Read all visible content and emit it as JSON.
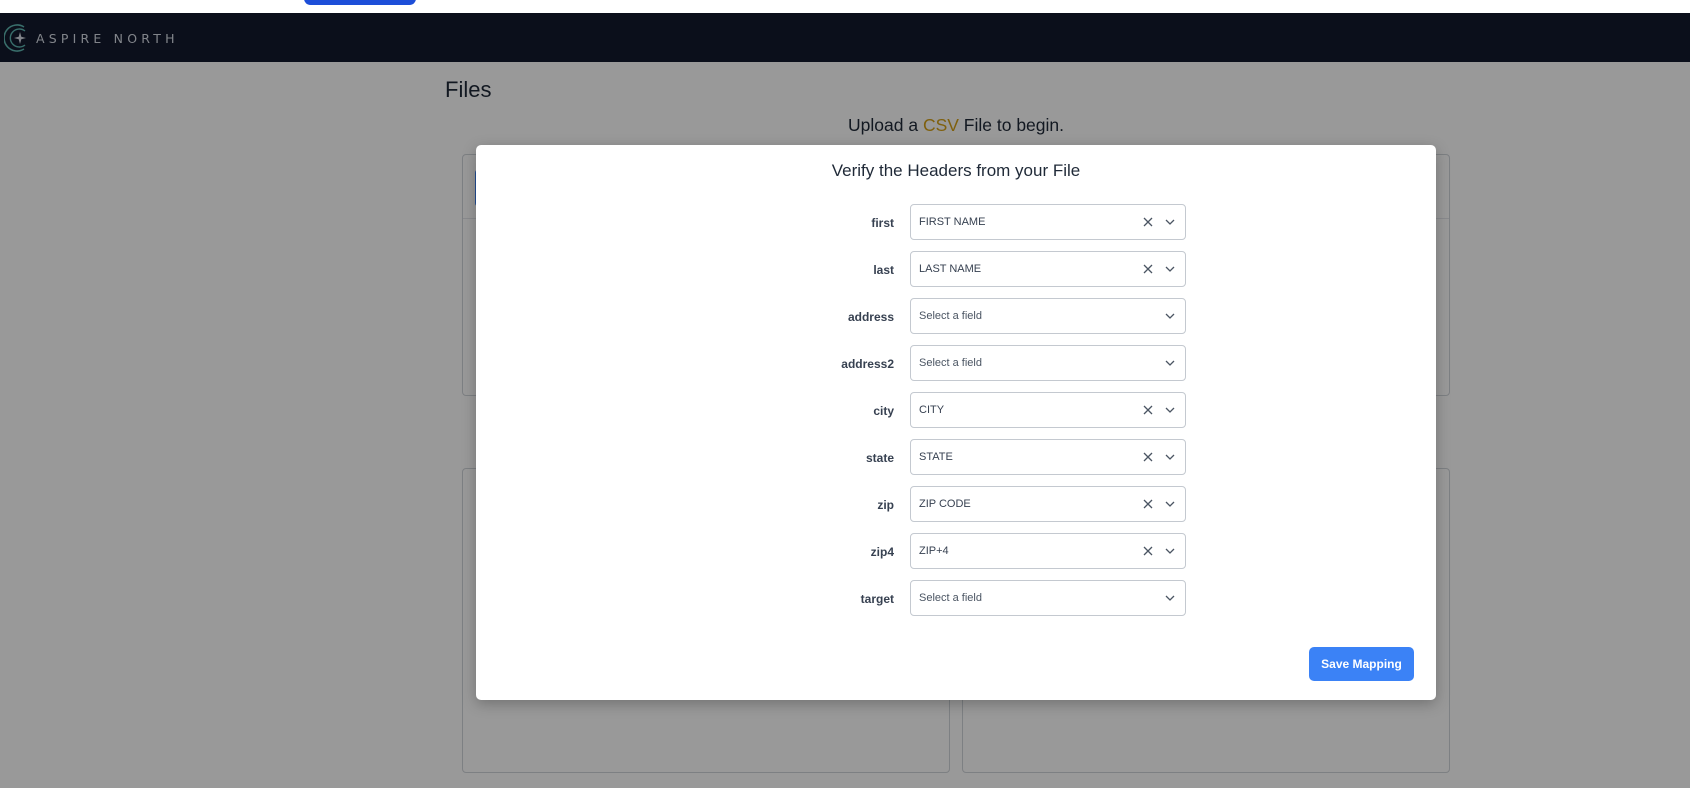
{
  "brand": {
    "name": "ASPIRE NORTH",
    "logo_icon": "compass-star-icon",
    "navbar_color": "#131a2e"
  },
  "page": {
    "title": "Files",
    "upload_hint_prefix": "Upload a",
    "upload_hint_accent": "CSV",
    "upload_hint_suffix": "File to begin.",
    "accent_color": "#d4a017"
  },
  "modal": {
    "title": "Verify the Headers from your File",
    "fields": [
      {
        "label": "first",
        "value": "FIRST NAME",
        "placeholder": false,
        "clearable": true
      },
      {
        "label": "last",
        "value": "LAST NAME",
        "placeholder": false,
        "clearable": true
      },
      {
        "label": "address",
        "value": "Select a field",
        "placeholder": true,
        "clearable": false
      },
      {
        "label": "address2",
        "value": "Select a field",
        "placeholder": true,
        "clearable": false
      },
      {
        "label": "city",
        "value": "CITY",
        "placeholder": false,
        "clearable": true
      },
      {
        "label": "state",
        "value": "STATE",
        "placeholder": false,
        "clearable": true
      },
      {
        "label": "zip",
        "value": "ZIP CODE",
        "placeholder": false,
        "clearable": true
      },
      {
        "label": "zip4",
        "value": "ZIP+4",
        "placeholder": false,
        "clearable": true
      },
      {
        "label": "target",
        "value": "Select a field",
        "placeholder": true,
        "clearable": false
      }
    ],
    "save_label": "Save Mapping",
    "button_color": "#3b82f6"
  }
}
